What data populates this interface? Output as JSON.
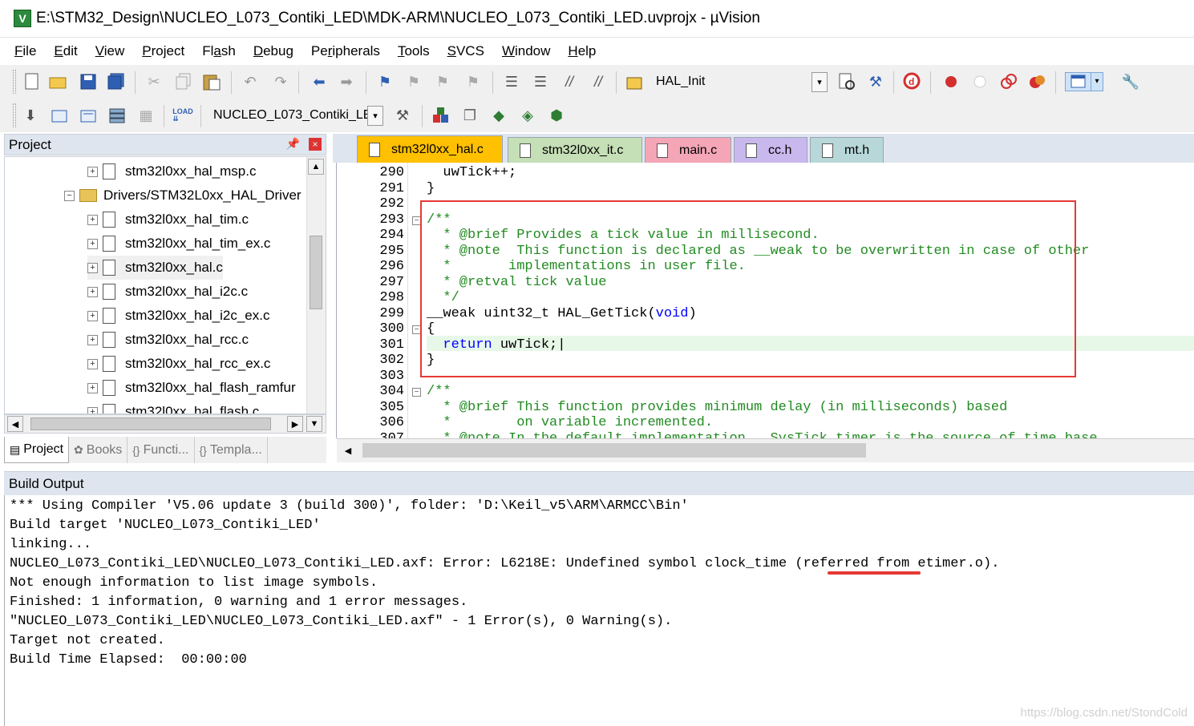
{
  "window": {
    "title": "E:\\STM32_Design\\NUCLEO_L073_Contiki_LED\\MDK-ARM\\NUCLEO_L073_Contiki_LED.uvprojx - µVision",
    "app_icon": "uvision-icon"
  },
  "menu": [
    {
      "label": "File",
      "accel": "F",
      "rest": "ile"
    },
    {
      "label": "Edit",
      "accel": "E",
      "rest": "dit"
    },
    {
      "label": "View",
      "accel": "V",
      "rest": "iew"
    },
    {
      "label": "Project",
      "accel": "P",
      "rest": "roject"
    },
    {
      "label": "Flash",
      "pre": "Fl",
      "accel": "a",
      "rest": "sh"
    },
    {
      "label": "Debug",
      "accel": "D",
      "rest": "ebug"
    },
    {
      "label": "Peripherals",
      "pre": "Pe",
      "accel": "r",
      "rest": "ipherals"
    },
    {
      "label": "Tools",
      "accel": "T",
      "rest": "ools"
    },
    {
      "label": "SVCS",
      "accel": "S",
      "rest": "VCS"
    },
    {
      "label": "Window",
      "accel": "W",
      "rest": "indow"
    },
    {
      "label": "Help",
      "accel": "H",
      "rest": "elp"
    }
  ],
  "toolbar1": {
    "find_combo_value": "HAL_Init"
  },
  "toolbar2": {
    "target_combo_value": "NUCLEO_L073_Contiki_LE"
  },
  "project_panel": {
    "title": "Project",
    "tree": [
      {
        "label": "stm32l0xx_hal_msp.c",
        "type": "file"
      },
      {
        "label": "Drivers/STM32L0xx_HAL_Driver",
        "type": "folder"
      },
      {
        "label": "stm32l0xx_hal_tim.c",
        "type": "file"
      },
      {
        "label": "stm32l0xx_hal_tim_ex.c",
        "type": "file"
      },
      {
        "label": "stm32l0xx_hal.c",
        "type": "file"
      },
      {
        "label": "stm32l0xx_hal_i2c.c",
        "type": "file"
      },
      {
        "label": "stm32l0xx_hal_i2c_ex.c",
        "type": "file"
      },
      {
        "label": "stm32l0xx_hal_rcc.c",
        "type": "file"
      },
      {
        "label": "stm32l0xx_hal_rcc_ex.c",
        "type": "file"
      },
      {
        "label": "stm32l0xx_hal_flash_ramfur",
        "type": "file"
      },
      {
        "label": "stm32l0xx_hal_flash.c",
        "type": "file"
      }
    ],
    "tabs": [
      {
        "label": "Project",
        "active": true
      },
      {
        "label": "Books",
        "active": false
      },
      {
        "label": "Functi...",
        "active": false
      },
      {
        "label": "Templa...",
        "active": false
      }
    ]
  },
  "editor": {
    "tabs": [
      {
        "label": "stm32l0xx_hal.c",
        "active": true,
        "color": "#ffc000"
      },
      {
        "label": "stm32l0xx_it.c",
        "active": false,
        "color": "#c5dfb6"
      },
      {
        "label": "main.c",
        "active": false,
        "color": "#f4a6b6"
      },
      {
        "label": "cc.h",
        "active": false,
        "color": "#c9b8ee"
      },
      {
        "label": "mt.h",
        "active": false,
        "color": "#b7d7d9"
      }
    ],
    "line_numbers": [
      "290",
      "291",
      "292",
      "293",
      "294",
      "295",
      "296",
      "297",
      "298",
      "299",
      "300",
      "301",
      "302",
      "303",
      "304",
      "305",
      "306",
      "307"
    ],
    "lines": [
      [
        {
          "t": "  uwTick++;",
          "c": ""
        }
      ],
      [
        {
          "t": "}",
          "c": ""
        }
      ],
      [
        {
          "t": "",
          "c": ""
        }
      ],
      [
        {
          "t": "/**",
          "c": "cm"
        }
      ],
      [
        {
          "t": "  * @brief Provides a tick value in millisecond.",
          "c": "cm"
        }
      ],
      [
        {
          "t": "  * @note  This function is declared as __weak to be overwritten in case of other",
          "c": "cm"
        }
      ],
      [
        {
          "t": "  *       implementations in user file.",
          "c": "cm"
        }
      ],
      [
        {
          "t": "  * @retval tick value",
          "c": "cm"
        }
      ],
      [
        {
          "t": "  */",
          "c": "cm"
        }
      ],
      [
        {
          "t": "__weak uint32_t HAL_GetTick(",
          "c": ""
        },
        {
          "t": "void",
          "c": "kw"
        },
        {
          "t": ")",
          "c": ""
        }
      ],
      [
        {
          "t": "{",
          "c": ""
        }
      ],
      [
        {
          "t": "  ",
          "c": ""
        },
        {
          "t": "return",
          "c": "kw"
        },
        {
          "t": " uwTick;|",
          "c": ""
        }
      ],
      [
        {
          "t": "}",
          "c": ""
        }
      ],
      [
        {
          "t": "",
          "c": ""
        }
      ],
      [
        {
          "t": "/**",
          "c": "cm"
        }
      ],
      [
        {
          "t": "  * @brief This function provides minimum delay (in milliseconds) based",
          "c": "cm"
        }
      ],
      [
        {
          "t": "  *        on variable incremented.",
          "c": "cm"
        }
      ],
      [
        {
          "t": "  * @note In the default implementation , SysTick timer is the source of time base",
          "c": "cm"
        }
      ]
    ]
  },
  "build_output": {
    "title": "Build Output",
    "lines": [
      "*** Using Compiler 'V5.06 update 3 (build 300)', folder: 'D:\\Keil_v5\\ARM\\ARMCC\\Bin'",
      "Build target 'NUCLEO_L073_Contiki_LED'",
      "linking...",
      "NUCLEO_L073_Contiki_LED\\NUCLEO_L073_Contiki_LED.axf: Error: L6218E: Undefined symbol clock_time (referred from etimer.o).",
      "Not enough information to list image symbols.",
      "Finished: 1 information, 0 warning and 1 error messages.",
      "\"NUCLEO_L073_Contiki_LED\\NUCLEO_L073_Contiki_LED.axf\" - 1 Error(s), 0 Warning(s).",
      "Target not created.",
      "Build Time Elapsed:  00:00:00"
    ]
  },
  "watermark": "https://blog.csdn.net/StondCold",
  "colors": {
    "annotation_red": "#e53935",
    "comment_green": "#228b22",
    "keyword_blue": "#0000ff"
  }
}
